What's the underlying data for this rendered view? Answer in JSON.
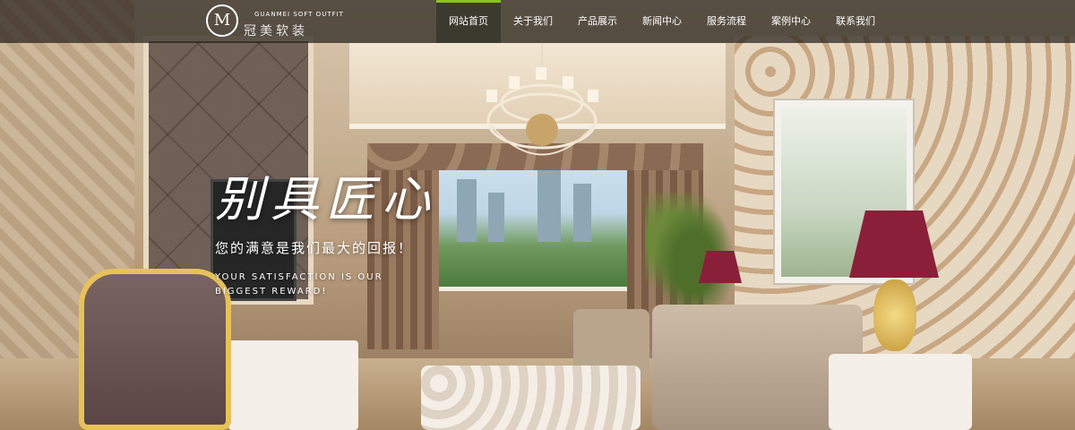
{
  "nav": {
    "logo": {
      "mark": "M",
      "brand": "冠美软装",
      "sub": "GUANMEI SOFT OUTFIT"
    },
    "items": [
      {
        "label": "网站首页",
        "active": true
      },
      {
        "label": "关于我们",
        "active": false
      },
      {
        "label": "产品展示",
        "active": false
      },
      {
        "label": "新闻中心",
        "active": false
      },
      {
        "label": "服务流程",
        "active": false
      },
      {
        "label": "案例中心",
        "active": false
      },
      {
        "label": "联系我们",
        "active": false
      }
    ]
  },
  "hero": {
    "headline": "别具匠心",
    "subline": "您的满意是我们最大的回报！",
    "english": "YOUR SATISFACTION IS OUR BIGGEST REWARD!"
  },
  "colors": {
    "accent": "#8dc21f",
    "nav_bg": "#26201b"
  }
}
